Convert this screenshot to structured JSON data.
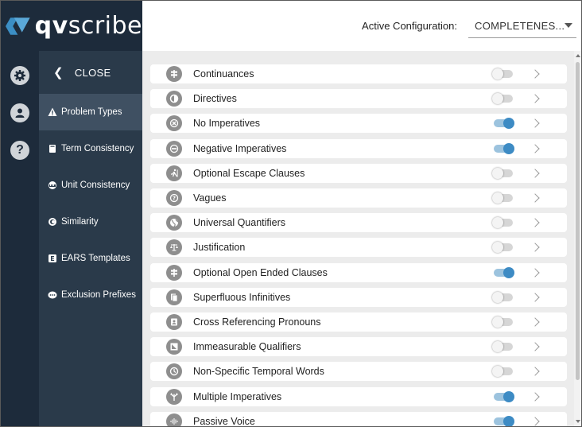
{
  "header": {
    "logo_prefix": "qv",
    "logo_suffix": "scribe",
    "config_label": "Active Configuration:",
    "config_value": "COMPLETENES..."
  },
  "rail": {
    "items": [
      {
        "icon": "gear-icon"
      },
      {
        "icon": "user-icon"
      },
      {
        "icon": "help-icon",
        "glyph": "?"
      }
    ]
  },
  "nav": {
    "close_label": "CLOSE",
    "items": [
      {
        "label": "Problem Types",
        "icon": "warning-icon",
        "active": true
      },
      {
        "label": "Term Consistency",
        "icon": "book-icon",
        "active": false
      },
      {
        "label": "Unit Consistency",
        "icon": "ruler-icon",
        "active": false
      },
      {
        "label": "Similarity",
        "icon": "similarity-icon",
        "active": false
      },
      {
        "label": "EARS Templates",
        "icon": "ears-icon",
        "active": false
      },
      {
        "label": "Exclusion Prefixes",
        "icon": "chat-icon",
        "active": false
      }
    ]
  },
  "problem_types": [
    {
      "label": "Continuances",
      "enabled": false,
      "icon": "signpost-icon"
    },
    {
      "label": "Directives",
      "enabled": false,
      "icon": "half-circle-icon"
    },
    {
      "label": "No Imperatives",
      "enabled": true,
      "icon": "x-circle-icon"
    },
    {
      "label": "Negative Imperatives",
      "enabled": true,
      "icon": "minus-circle-icon"
    },
    {
      "label": "Optional Escape Clauses",
      "enabled": false,
      "icon": "running-person-icon"
    },
    {
      "label": "Vagues",
      "enabled": false,
      "icon": "question-icon"
    },
    {
      "label": "Universal Quantifiers",
      "enabled": false,
      "icon": "globe-icon"
    },
    {
      "label": "Justification",
      "enabled": false,
      "icon": "scales-icon"
    },
    {
      "label": "Optional Open Ended Clauses",
      "enabled": true,
      "icon": "signpost-icon"
    },
    {
      "label": "Superfluous Infinitives",
      "enabled": false,
      "icon": "pages-icon"
    },
    {
      "label": "Cross Referencing Pronouns",
      "enabled": false,
      "icon": "contact-icon"
    },
    {
      "label": "Immeasurable Qualifiers",
      "enabled": false,
      "icon": "chart-icon"
    },
    {
      "label": "Non-Specific Temporal Words",
      "enabled": false,
      "icon": "clock-icon"
    },
    {
      "label": "Multiple Imperatives",
      "enabled": true,
      "icon": "split-arrows-icon"
    },
    {
      "label": "Passive Voice",
      "enabled": true,
      "icon": "audio-icon"
    }
  ],
  "colors": {
    "sidebar_dark": "#1d2b3b",
    "nav_bg": "#2a3a4a",
    "nav_active": "#3f5062",
    "toggle_on": "#3d8bc4",
    "logo_accent": "#3b8ec4"
  }
}
